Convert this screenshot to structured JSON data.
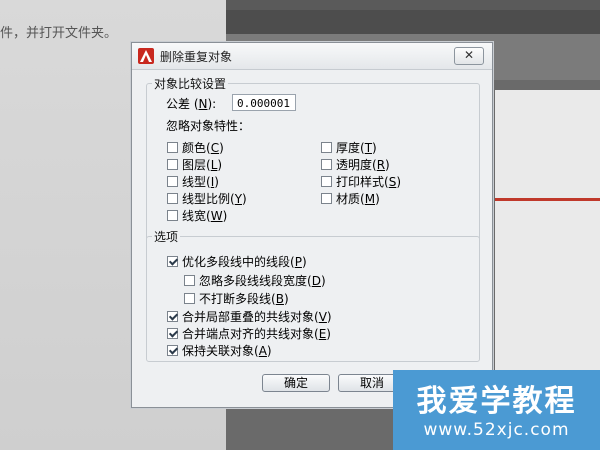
{
  "background": {
    "doc_text": "件，并打开文件夹。"
  },
  "dialog": {
    "title": "删除重复对象",
    "close_icon": "close-x",
    "app_icon": "autocad-logo",
    "compare_group": {
      "label": "对象比较设置",
      "tolerance_label": "公差",
      "tolerance_key": "N",
      "tolerance_value": "0.000001",
      "ignore_label": "忽略对象特性："
    },
    "properties": [
      {
        "label": "颜色",
        "key": "C",
        "checked": false
      },
      {
        "label": "图层",
        "key": "L",
        "checked": false
      },
      {
        "label": "线型",
        "key": "I",
        "checked": false
      },
      {
        "label": "线型比例",
        "key": "Y",
        "checked": false
      },
      {
        "label": "线宽",
        "key": "W",
        "checked": false
      },
      {
        "label": "厚度",
        "key": "T",
        "checked": false
      },
      {
        "label": "透明度",
        "key": "R",
        "checked": false
      },
      {
        "label": "打印样式",
        "key": "S",
        "checked": false
      },
      {
        "label": "材质",
        "key": "M",
        "checked": false
      }
    ],
    "options_group": {
      "label": "选项",
      "items": [
        {
          "label": "优化多段线中的线段",
          "key": "P",
          "checked": true
        },
        {
          "label": "忽略多段线线段宽度",
          "key": "D",
          "checked": false
        },
        {
          "label": "不打断多段线",
          "key": "B",
          "checked": false
        },
        {
          "label": "合并局部重叠的共线对象",
          "key": "V",
          "checked": true
        },
        {
          "label": "合并端点对齐的共线对象",
          "key": "E",
          "checked": true
        },
        {
          "label": "保持关联对象",
          "key": "A",
          "checked": true
        }
      ]
    },
    "ok_label": "确定",
    "cancel_label": "取消"
  },
  "watermark": {
    "main": "我爱学教程",
    "sub": "www.52xjc.com"
  }
}
